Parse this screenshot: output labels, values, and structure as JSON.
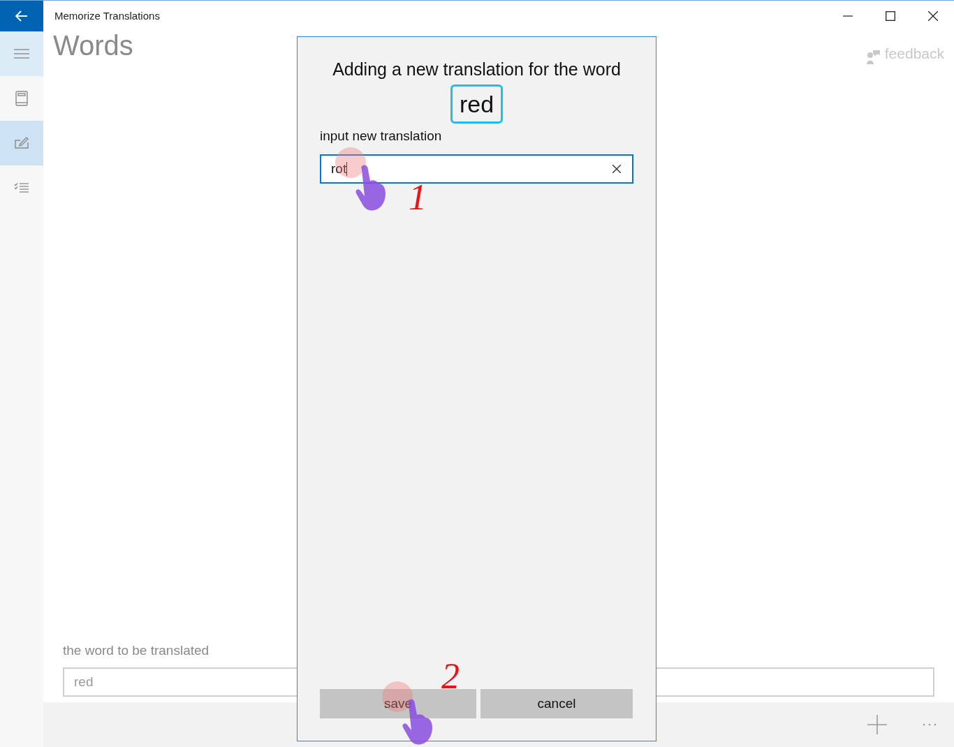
{
  "window": {
    "title": "Memorize Translations"
  },
  "sidebar": {
    "items": [
      {
        "kind": "book",
        "selected": false
      },
      {
        "kind": "edit",
        "selected": true
      },
      {
        "kind": "checklist",
        "selected": false
      }
    ]
  },
  "page": {
    "title": "Words",
    "feedback": "feedback"
  },
  "word_field": {
    "label": "the word to be translated",
    "value": "red"
  },
  "dialog": {
    "heading": "Adding a new translation for the word",
    "word": "red",
    "field_label": "input new translation",
    "value": "rot",
    "buttons": [
      {
        "label": "save"
      },
      {
        "label": "cancel"
      }
    ]
  },
  "annotations": [
    {
      "label": "1"
    },
    {
      "label": "2"
    }
  ]
}
